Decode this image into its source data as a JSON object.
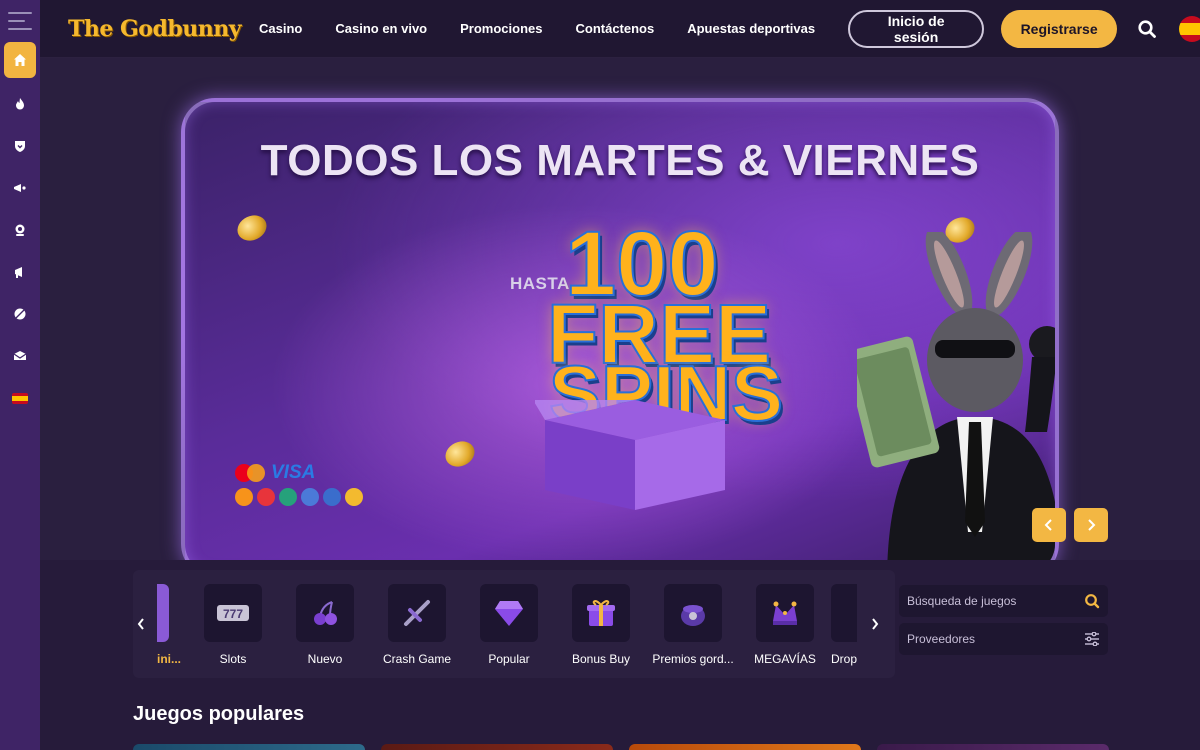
{
  "header": {
    "logo": "The Godbunny",
    "nav": [
      "Casino",
      "Casino en vivo",
      "Promociones",
      "Contáctenos",
      "Apuestas deportivas"
    ],
    "login_label": "Inicio de sesión",
    "register_label": "Registrarse",
    "language_icon": "spain-flag-icon"
  },
  "sidebar": {
    "items": [
      "menu-toggle-icon",
      "home-icon",
      "fire-icon",
      "shield-icon",
      "megaphone-icon",
      "support-icon",
      "announce-icon",
      "sports-ball-icon",
      "envelope-icon",
      "spain-flag-icon"
    ]
  },
  "banner": {
    "title": "TODOS LOS MARTES & VIERNES",
    "prefix": "HASTA",
    "amount": "100",
    "line2": "FREE",
    "line3": "SPINS",
    "payment_visa": "VISA"
  },
  "categories": {
    "active_label": "ini...",
    "items": [
      "Slots",
      "Nuevo",
      "Crash Game",
      "Popular",
      "Bonus Buy",
      "Premios gord...",
      "MEGAVÍAS",
      "Drop"
    ]
  },
  "search": {
    "placeholder": "Búsqueda de juegos",
    "providers_label": "Proveedores"
  },
  "popular": {
    "title": "Juegos populares"
  },
  "colors": {
    "accent": "#f3b743",
    "sidebar": "#3f2466",
    "header": "#201732",
    "background": "#261b3a"
  }
}
